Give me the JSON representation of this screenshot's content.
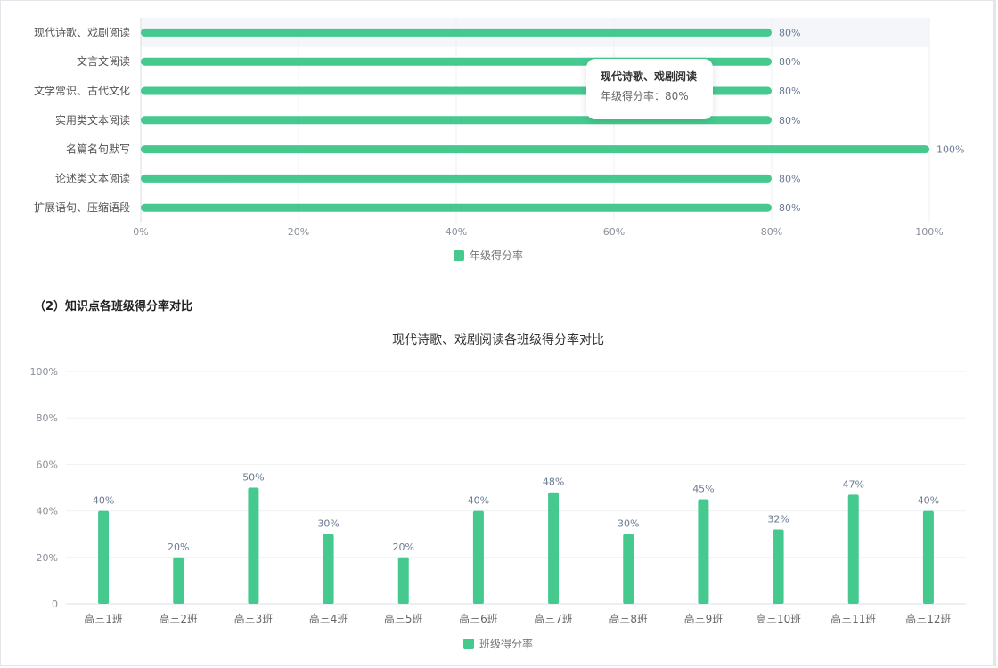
{
  "section_title": "（2）知识点各班级得分率对比",
  "tooltip": {
    "title": "现代诗歌、戏剧阅读",
    "series_label": "年级得分率",
    "separator": "：",
    "value": "80%"
  },
  "colors": {
    "bar": "#45c98f",
    "grid": "#eef0f3",
    "axis_text": "#8a8f99",
    "value_label": "#6a7a92",
    "highlight": "#f4f6fa"
  },
  "chart_data": [
    {
      "type": "bar",
      "orientation": "horizontal",
      "categories": [
        "现代诗歌、戏剧阅读",
        "文言文阅读",
        "文学常识、古代文化",
        "实用类文本阅读",
        "名篇名句默写",
        "论述类文本阅读",
        "扩展语句、压缩语段"
      ],
      "series": [
        {
          "name": "年级得分率",
          "values": [
            80,
            80,
            80,
            80,
            100,
            80,
            80
          ]
        }
      ],
      "value_labels": [
        "80%",
        "80%",
        "80%",
        "80%",
        "100%",
        "80%",
        "80%"
      ],
      "xlim": [
        0,
        100
      ],
      "xticks": [
        "0%",
        "20%",
        "40%",
        "60%",
        "80%",
        "100%"
      ],
      "highlighted_category": "现代诗歌、戏剧阅读",
      "grid": true,
      "legend": "bottom-center"
    },
    {
      "type": "bar",
      "title": "现代诗歌、戏剧阅读各班级得分率对比",
      "categories": [
        "高三1班",
        "高三2班",
        "高三3班",
        "高三4班",
        "高三5班",
        "高三6班",
        "高三7班",
        "高三8班",
        "高三9班",
        "高三10班",
        "高三11班",
        "高三12班"
      ],
      "series": [
        {
          "name": "班级得分率",
          "values": [
            40,
            20,
            50,
            30,
            20,
            40,
            48,
            30,
            45,
            32,
            47,
            40
          ]
        }
      ],
      "value_labels": [
        "40%",
        "20%",
        "50%",
        "30%",
        "20%",
        "40%",
        "48%",
        "30%",
        "45%",
        "32%",
        "47%",
        "40%"
      ],
      "ylim": [
        0,
        100
      ],
      "yticks": [
        "0",
        "20%",
        "40%",
        "60%",
        "80%",
        "100%"
      ],
      "grid": true,
      "legend": "bottom-center"
    }
  ]
}
